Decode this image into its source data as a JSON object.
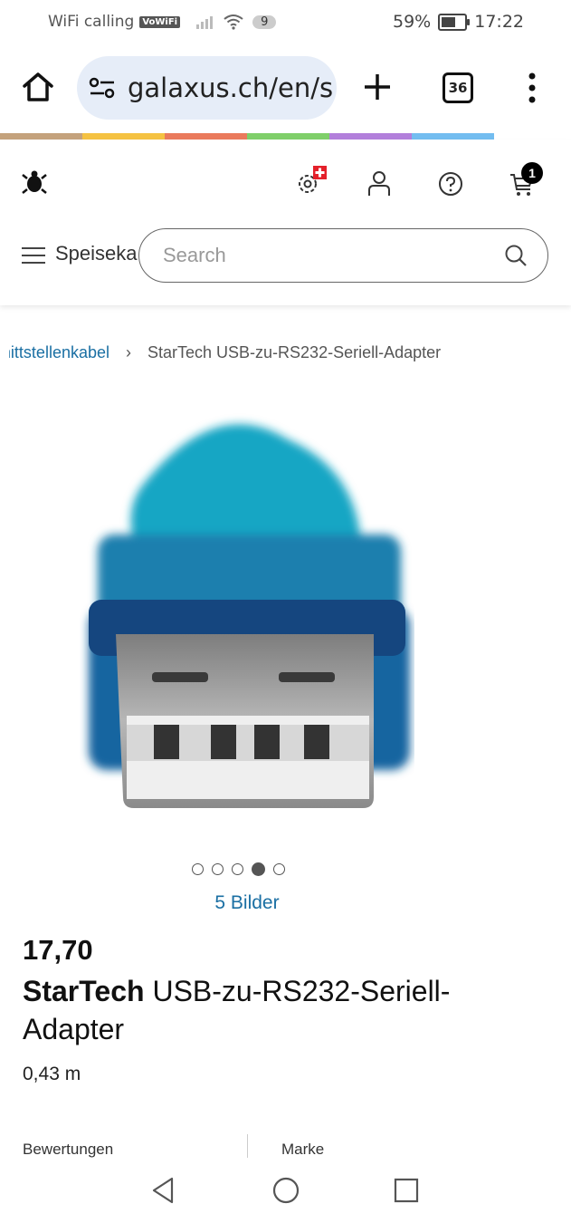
{
  "status_bar": {
    "carrier": "WiFi calling",
    "vowifi": "VoWiFi",
    "notif_count": "9",
    "battery": "59%",
    "time": "17:22"
  },
  "browser": {
    "url": "galaxus.ch/en/s",
    "tab_count": "36"
  },
  "stripe_colors": [
    "#c4a27c",
    "#f5c242",
    "#ea7a5c",
    "#7fcf6a",
    "#b27fdb",
    "#73bdf0"
  ],
  "header": {
    "menu_label": "Speisekarte",
    "search_placeholder": "Search",
    "cart_count": "1"
  },
  "breadcrumb": {
    "parent": "Schnittstellenkabel",
    "current": "StarTech USB-zu-RS232-Seriell-Adapter"
  },
  "gallery": {
    "image_count_label": "5 Bilder",
    "total": 5,
    "active_index": 3
  },
  "product": {
    "price": "17,70",
    "brand": "StarTech",
    "name": "USB-zu-RS232-Seriell-Adapter",
    "length": "0,43 m"
  },
  "tabs": {
    "ratings": "Bewertungen",
    "brand": "Marke"
  },
  "colors": {
    "link": "#1a6fa3",
    "swiss_red": "#e4202a"
  }
}
